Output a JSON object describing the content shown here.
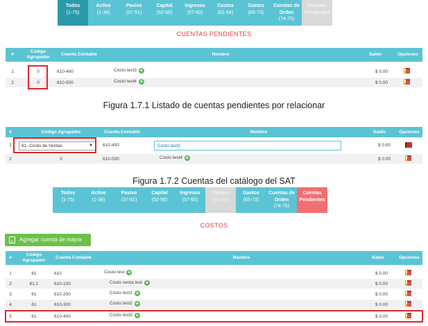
{
  "figure1": {
    "tabs": [
      {
        "label": "Todos",
        "range": "(1-75)",
        "style": "darkteal"
      },
      {
        "label": "Activo",
        "range": "(1-36)",
        "style": "teal"
      },
      {
        "label": "Pasivo",
        "range": "(37-51)",
        "style": "teal"
      },
      {
        "label": "Capital",
        "range": "(52-56)",
        "style": "teal"
      },
      {
        "label": "Ingresos",
        "range": "(57-60)",
        "style": "teal"
      },
      {
        "label": "Costos",
        "range": "(61-64)",
        "style": "teal"
      },
      {
        "label": "Gastos",
        "range": "(65-73)",
        "style": "teal"
      },
      {
        "label": "Cuentas de Orden",
        "range": "(74-75)",
        "style": "teal"
      },
      {
        "label": "Cuentas Pendientes",
        "range": "",
        "style": "grey"
      }
    ],
    "section_title": "CUENTAS PENDIENTES",
    "headers": {
      "num": "#",
      "codigo": "Código Agrupador",
      "cuenta": "Cuenta Contable",
      "nombre": "Nombre",
      "saldo": "Saldo",
      "opciones": "Opciones"
    },
    "rows": [
      {
        "num": "1",
        "codigo": "0",
        "cuenta": "610-400",
        "nombre": "Costo test3",
        "saldo": "$ 0.00"
      },
      {
        "num": "2",
        "codigo": "0",
        "cuenta": "610-500",
        "nombre": "Costo test4",
        "saldo": "$ 0.00"
      }
    ],
    "caption": "Figura 1.7.1 Listado de cuentas pendientes por relacionar"
  },
  "figure2": {
    "headers": {
      "num": "#",
      "codigo": "Código Agrupador",
      "cuenta": "Cuenta Contable",
      "nombre": "Nombre",
      "saldo": "Saldo",
      "opciones": "Opciones"
    },
    "rows": [
      {
        "num": "1",
        "codigo_select": "61.-Costo de Ventas",
        "cuenta": "610-400",
        "nombre_input": "Costo test3",
        "saldo": "$ 0.00"
      },
      {
        "num": "2",
        "codigo": "0",
        "cuenta": "610-500",
        "nombre": "Costo test4",
        "saldo": "$ 0.00"
      }
    ],
    "caption": "Figura 1.7.2 Cuentas del catálogo del SAT"
  },
  "figure3": {
    "tabs": [
      {
        "label": "Todos",
        "range": "(1-75)",
        "style": "teal"
      },
      {
        "label": "Activo",
        "range": "(1-36)",
        "style": "teal"
      },
      {
        "label": "Pasivo",
        "range": "(37-51)",
        "style": "teal"
      },
      {
        "label": "Capital",
        "range": "(52-56)",
        "style": "teal"
      },
      {
        "label": "Ingresos",
        "range": "(57-60)",
        "style": "teal"
      },
      {
        "label": "Costos",
        "range": "(61-64)",
        "style": "grey"
      },
      {
        "label": "Gastos",
        "range": "(65-73)",
        "style": "teal"
      },
      {
        "label": "Cuentas de Orden",
        "range": "(74-75)",
        "style": "teal"
      },
      {
        "label": "Cuentas Pendientes",
        "range": "",
        "style": "red"
      }
    ],
    "section_title": "COSTOS",
    "add_button": "Agregar cuenta de mayor",
    "headers": {
      "num": "#",
      "codigo": "Código Agrupador",
      "cuenta": "Cuenta Contable",
      "nombre": "Nombre",
      "saldo": "Saldo",
      "opciones": "Opciones"
    },
    "rows": [
      {
        "num": "1",
        "codigo": "61",
        "cuenta": "610",
        "nombre": "Costo test",
        "saldo": "$ 0.00"
      },
      {
        "num": "2",
        "codigo": "61.1",
        "cuenta": "610-100",
        "nombre": "Costo venta test",
        "saldo": "$ 0.00"
      },
      {
        "num": "3",
        "codigo": "61",
        "cuenta": "610-200",
        "nombre": "Costo test1",
        "saldo": "$ 0.00"
      },
      {
        "num": "4",
        "codigo": "61",
        "cuenta": "610-300",
        "nombre": "Costo test2",
        "saldo": "$ 0.00"
      },
      {
        "num": "5",
        "codigo": "61",
        "cuenta": "610-400",
        "nombre": "Costo test3",
        "saldo": "$ 0.00"
      }
    ]
  }
}
